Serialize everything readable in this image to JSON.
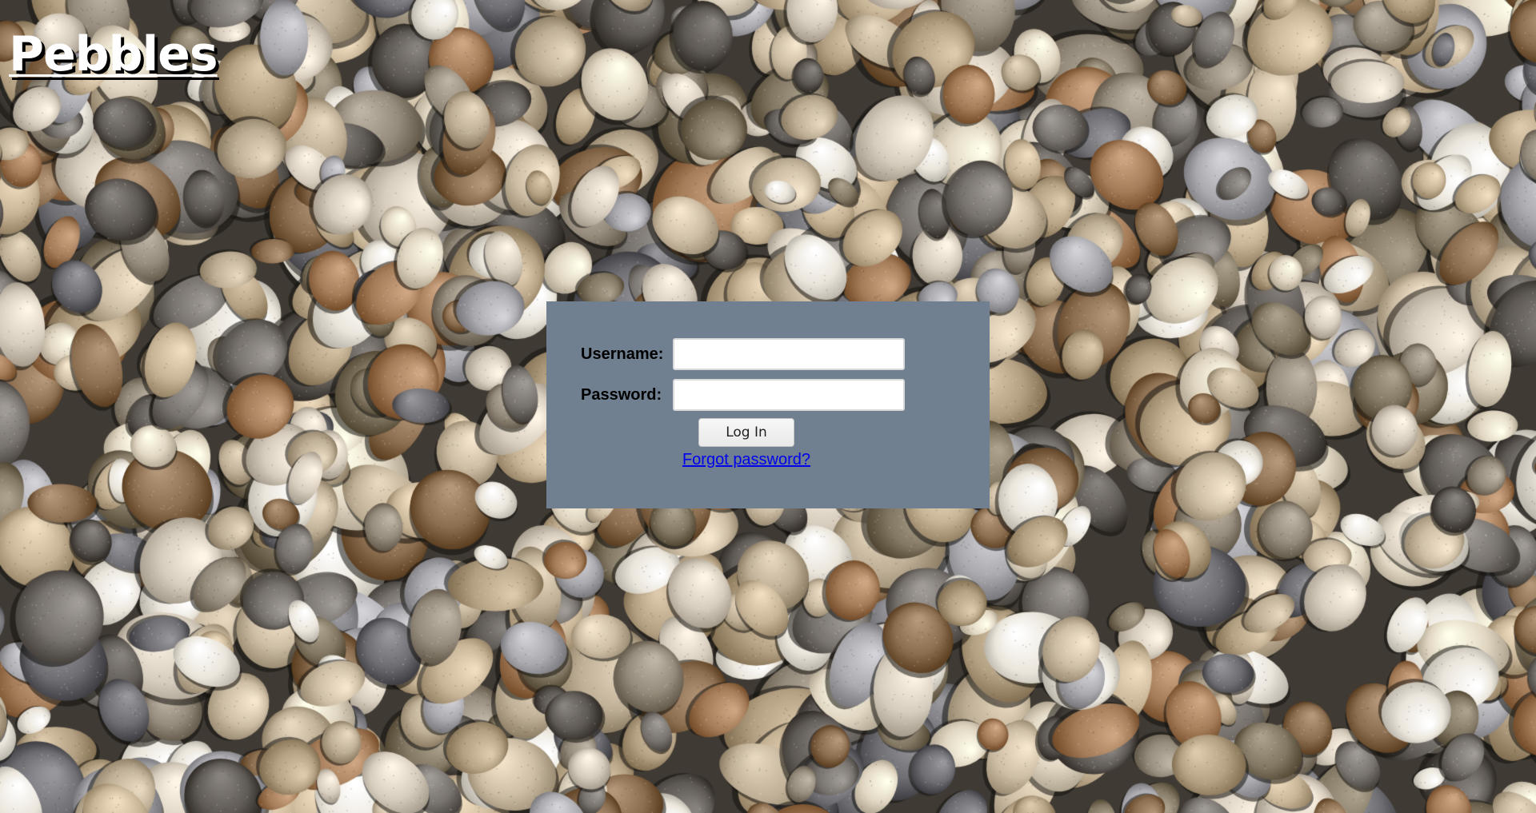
{
  "page": {
    "title": "Pebbles",
    "background": "pebbles-photo"
  },
  "login": {
    "username_label": "Username:",
    "username_value": "",
    "password_label": "Password:",
    "password_value": "",
    "submit_label": "Log In",
    "forgot_link": "Forgot password?"
  },
  "colors": {
    "panel": "#708090",
    "link": "#0000ee",
    "title_text": "#ffffff",
    "title_shadow": "#000000"
  }
}
